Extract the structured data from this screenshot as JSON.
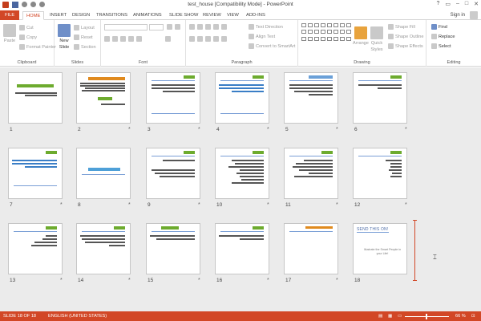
{
  "window": {
    "title": "test_house [Compatibility Mode] - PowerPoint",
    "controls": [
      "?",
      "▭",
      "–",
      "□",
      "✕"
    ],
    "sign_in": "Sign in"
  },
  "tabs": [
    {
      "label": "FILE",
      "kind": "file"
    },
    {
      "label": "HOME",
      "kind": "active"
    },
    {
      "label": "INSERT"
    },
    {
      "label": "DESIGN"
    },
    {
      "label": "TRANSITIONS"
    },
    {
      "label": "ANIMATIONS"
    },
    {
      "label": "SLIDE SHOW"
    },
    {
      "label": "REVIEW"
    },
    {
      "label": "VIEW"
    },
    {
      "label": "ADD-INS"
    }
  ],
  "ribbon": {
    "clipboard": {
      "label": "Clipboard",
      "paste": "Paste",
      "cut": "Cut",
      "copy": "Copy",
      "format_painter": "Format Painter"
    },
    "slides": {
      "label": "Slides",
      "new_slide": "New",
      "new_slide2": "Slide",
      "layout": "Layout",
      "reset": "Reset",
      "section": "Section"
    },
    "font": {
      "label": "Font"
    },
    "paragraph": {
      "label": "Paragraph",
      "text_direction": "Text Direction",
      "align_text": "Align Text",
      "smartart": "Convert to SmartArt"
    },
    "drawing": {
      "label": "Drawing",
      "arrange": "Arrange",
      "quick_styles": "Quick",
      "quick_styles2": "Styles",
      "shape_fill": "Shape Fill",
      "shape_outline": "Shape Outline",
      "shape_effects": "Shape Effects"
    },
    "editing": {
      "label": "Editing",
      "find": "Find",
      "replace": "Replace",
      "select": "Select"
    }
  },
  "slides": [
    {
      "num": "1",
      "star": ""
    },
    {
      "num": "2",
      "star": "*"
    },
    {
      "num": "3",
      "star": "*"
    },
    {
      "num": "4",
      "star": "*"
    },
    {
      "num": "5",
      "star": "*"
    },
    {
      "num": "6",
      "star": "*"
    },
    {
      "num": "7",
      "star": "*"
    },
    {
      "num": "8",
      "star": "*"
    },
    {
      "num": "9",
      "star": "*"
    },
    {
      "num": "10",
      "star": "*"
    },
    {
      "num": "11",
      "star": "*"
    },
    {
      "num": "12",
      "star": "*"
    },
    {
      "num": "13",
      "star": "*"
    },
    {
      "num": "14",
      "star": "*"
    },
    {
      "num": "15",
      "star": "*"
    },
    {
      "num": "16",
      "star": "*"
    },
    {
      "num": "17",
      "star": "*"
    },
    {
      "num": "18",
      "star": ""
    }
  ],
  "slide18": {
    "title": "SEND THIS ON!",
    "body": "Illustrate the Smart People in your Life!"
  },
  "status": {
    "slide_counter": "SLIDE 18 OF 18",
    "language": "ENGLISH (UNITED STATES)",
    "zoom": "66 %"
  },
  "colors": {
    "accent": "#d24726",
    "title_green": "#6dab2e",
    "rule_blue": "#7a9fd6"
  }
}
